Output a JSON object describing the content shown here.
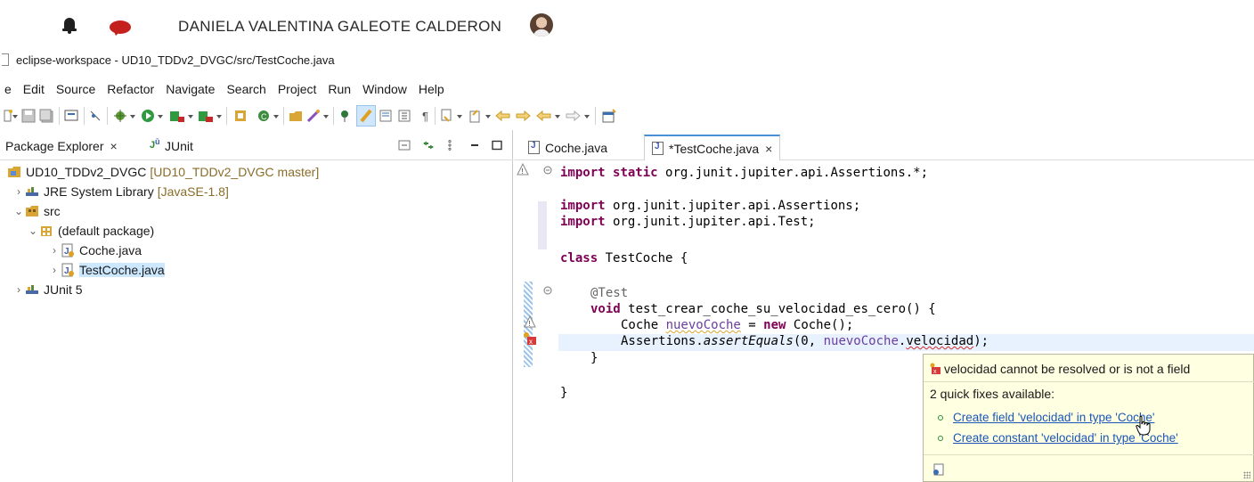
{
  "meeting": {
    "user_name": "DANIELA VALENTINA GALEOTE CALDERON"
  },
  "window": {
    "title": "eclipse-workspace - UD10_TDDv2_DVGC/src/TestCoche.java"
  },
  "menu": [
    "e",
    "Edit",
    "Source",
    "Refactor",
    "Navigate",
    "Search",
    "Project",
    "Run",
    "Window",
    "Help"
  ],
  "left_panel": {
    "tab_package_explorer": "Package Explorer",
    "tab_junit": "JUnit",
    "tree": {
      "project": "UD10_TDDv2_DVGC",
      "project_decoration": "[UD10_TDDv2_DVGC master]",
      "jre": "JRE System Library",
      "jre_decoration": "[JavaSE-1.8]",
      "src": "src",
      "default_package": "(default package)",
      "file1": "Coche.java",
      "file2": "TestCoche.java",
      "junit": "JUnit 5"
    }
  },
  "editor": {
    "tab1": "Coche.java",
    "tab2": "*TestCoche.java",
    "code": {
      "l1_kw1": "import",
      "l1_kw2": "static",
      "l1_rest": " org.junit.jupiter.api.Assertions.*;",
      "l3_kw": "import",
      "l3_rest": " org.junit.jupiter.api.Assertions;",
      "l4_kw": "import",
      "l4_rest": " org.junit.jupiter.api.Test;",
      "l6_kw": "class",
      "l6_rest": " TestCoche {",
      "l8_ann": "@Test",
      "l9_kw": "void",
      "l9_rest": " test_crear_coche_su_velocidad_es_cero() {",
      "l10_a": "Coche ",
      "l10_var": "nuevoCoche",
      "l10_b": " = ",
      "l10_kw": "new",
      "l10_c": " Coche();",
      "l11_a": "Assertions.",
      "l11_method": "assertEquals",
      "l11_b": "(0, ",
      "l11_var": "nuevoCoche",
      "l11_c": ".",
      "l11_err": "velocidad",
      "l11_d": ");",
      "l12": "}",
      "l14": "}"
    }
  },
  "popup": {
    "error": "velocidad cannot be resolved or is not a field",
    "fixes_count": "2 quick fixes available:",
    "fix1": "Create field 'velocidad' in type 'Coche'",
    "fix2": "Create constant 'velocidad' in type 'Coche'"
  },
  "colors": {
    "keyword": "#7f0055",
    "annotation": "#646464",
    "field": "#6a3e9e",
    "link": "#1a56b8",
    "popup_bg": "#ffffe1",
    "selection": "#cce8ff"
  }
}
